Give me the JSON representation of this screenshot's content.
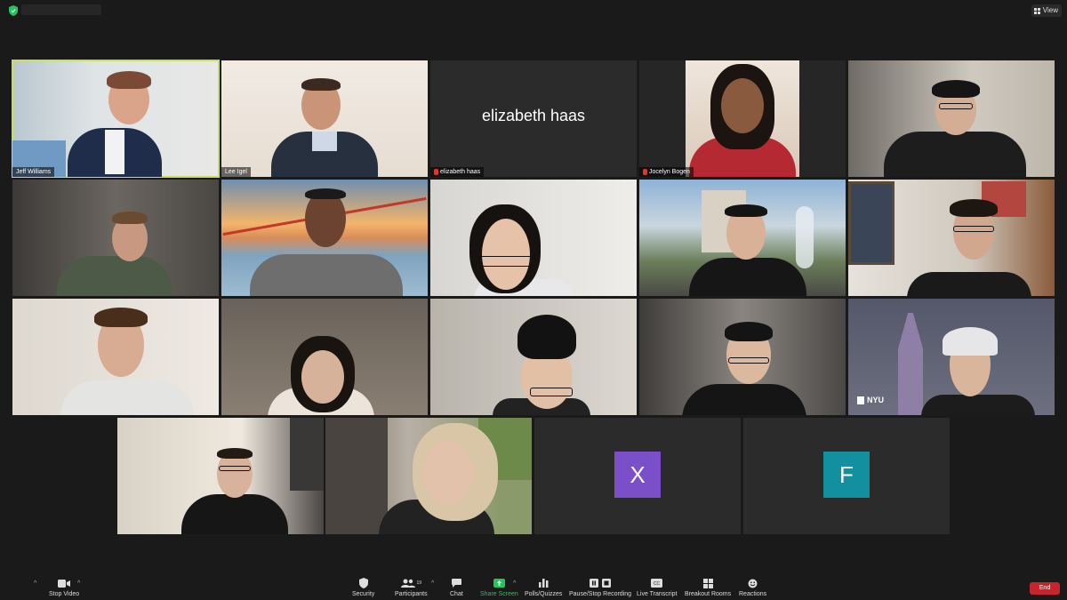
{
  "top_bar": {
    "view_label": "View"
  },
  "participants": [
    {
      "name": "Jeff Williams"
    },
    {
      "name": "Lee Igel"
    },
    {
      "name": "elizabeth haas",
      "display": "elizabeth haas"
    },
    {
      "name": "Jocelyn Bogen"
    }
  ],
  "avatars": {
    "x_letter": "X",
    "f_letter": "F"
  },
  "background_logo": "NYU",
  "toolbar": {
    "stop_video": "Stop Video",
    "security": "Security",
    "participants": "Participants",
    "participants_count": "19",
    "chat": "Chat",
    "share_screen": "Share Screen",
    "polls": "Polls/Quizzes",
    "recording": "Pause/Stop Recording",
    "transcript": "Live Transcript",
    "breakout": "Breakout Rooms",
    "reactions": "Reactions",
    "end": "End"
  },
  "colors": {
    "active_speaker": "#c6de63",
    "x_avatar": "#7b4fc9",
    "f_avatar": "#13909f",
    "end": "#c7242b",
    "share": "#22c55e"
  }
}
